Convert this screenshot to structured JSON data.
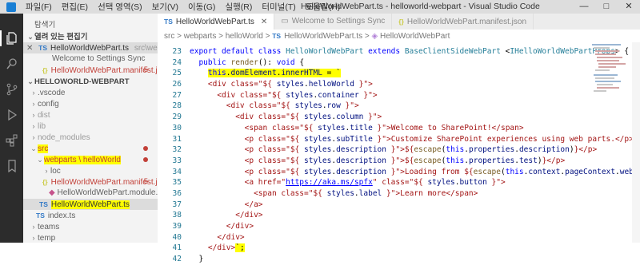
{
  "menu": [
    "파일(F)",
    "편집(E)",
    "선택 영역(S)",
    "보기(V)",
    "이동(G)",
    "실행(R)",
    "터미널(T)",
    "도움말(H)"
  ],
  "window_title": "HelloWorldWebPart.ts - helloworld-webpart - Visual Studio Code",
  "window_controls": [
    "—",
    "□",
    "✕"
  ],
  "activity_icons": [
    "files-icon",
    "search-icon",
    "source-control-icon",
    "run-debug-icon",
    "extensions-icon",
    "bookmark-icon"
  ],
  "sidebar": {
    "title": "탐색기",
    "open_editors_label": "열려 있는 편집기",
    "open_editors": [
      {
        "type": "TS",
        "name": "HelloWorldWebPart.ts",
        "path": "src\\webparts...",
        "close": "✕"
      },
      {
        "type": "",
        "name": "Welcome to Settings Sync",
        "path": ""
      },
      {
        "type": "{}",
        "name": "HelloWorldWebPart.manifest.js...",
        "badge": "5"
      }
    ],
    "project_label": "HELLOWORLD-WEBPART",
    "tree": [
      {
        "chev": "›",
        "name": ".vscode"
      },
      {
        "chev": "›",
        "name": "config"
      },
      {
        "chev": "›",
        "name": "dist"
      },
      {
        "chev": "›",
        "name": "lib"
      },
      {
        "chev": "›",
        "name": "node_modules"
      },
      {
        "chev": "⌄",
        "name": "src"
      },
      {
        "chev": "⌄",
        "name": "webparts \\ helloWorld"
      },
      {
        "chev": "›",
        "name": "loc"
      },
      {
        "chev": "",
        "type": "{}",
        "name": "HelloWorldWebPart.manifest.js...",
        "badge": "5"
      },
      {
        "chev": "",
        "type": "",
        "name": "HelloWorldWebPart.module.scss"
      },
      {
        "chev": "",
        "type": "TS",
        "name": "HelloWorldWebPart.ts"
      },
      {
        "chev": "",
        "type": "TS",
        "name": "index.ts"
      },
      {
        "chev": "›",
        "name": "teams"
      },
      {
        "chev": "›",
        "name": "temp"
      }
    ]
  },
  "tabs": [
    {
      "type": "TS",
      "label": "HelloWorldWebPart.ts",
      "close": "✕"
    },
    {
      "type": "",
      "label": "Welcome to Settings Sync"
    },
    {
      "type": "{}",
      "label": "HelloWorldWebPart.manifest.json"
    }
  ],
  "breadcrumb": [
    "src",
    ">",
    "webparts",
    ">",
    "helloWorld",
    ">",
    "TS",
    "HelloWorldWebPart.ts",
    ">",
    "HelloWorldWebPart"
  ],
  "line_numbers": [
    "23",
    "24",
    "25",
    "26",
    "27",
    "28",
    "29",
    "30",
    "31",
    "32",
    "33",
    "34",
    "35",
    "36",
    "37",
    "38",
    "39",
    "40",
    "41",
    "42"
  ],
  "colors": {
    "highlight": "#ffff00",
    "error": "#c24038",
    "keyword": "#0000ff"
  }
}
